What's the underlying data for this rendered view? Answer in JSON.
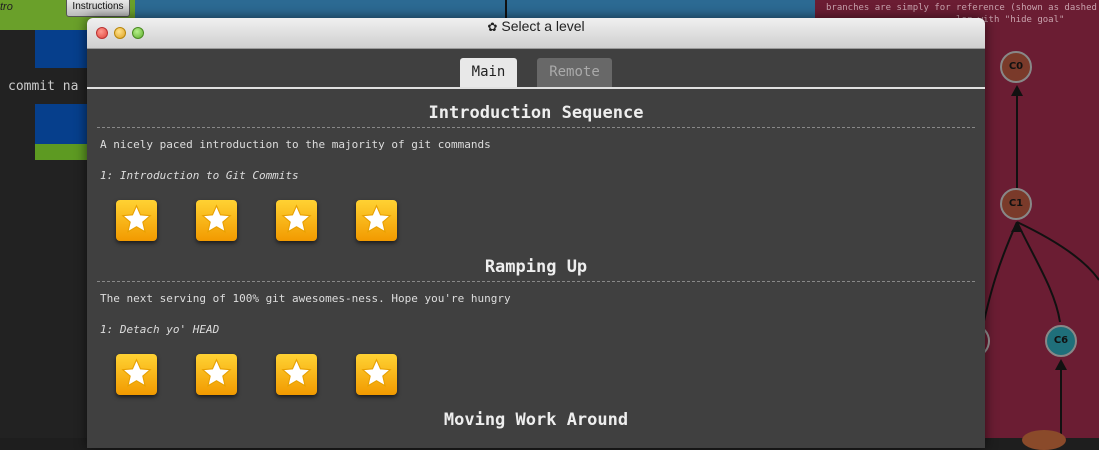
{
  "background": {
    "intro_label": "tro",
    "instructions_button": "Instructions",
    "commit_text": "commit na",
    "right_panel_text": "branches are simply for reference (shown as dashed\n                        log with \"hide goal\"",
    "nodes": [
      {
        "label": "C0",
        "color": "#7a3a2a"
      },
      {
        "label": "C1",
        "color": "#7a3a2a"
      },
      {
        "label": "C6",
        "color": "#1f6f7a"
      }
    ]
  },
  "dialog": {
    "title": "Select a level",
    "gear_icon": "gear-icon",
    "tabs": [
      {
        "label": "Main",
        "active": true
      },
      {
        "label": "Remote",
        "active": false
      }
    ],
    "sequences": [
      {
        "title": "Introduction Sequence",
        "description": "A nicely paced introduction to the majority of git commands",
        "level_label": "1: Introduction to Git Commits",
        "stars": 4
      },
      {
        "title": "Ramping Up",
        "description": "The next serving of 100% git awesomes-ness. Hope you're hungry",
        "level_label": "1: Detach yo' HEAD",
        "stars": 4
      },
      {
        "title": "Moving Work Around",
        "description": "",
        "level_label": "",
        "stars": 0
      }
    ]
  },
  "colors": {
    "dialog_bg": "#404040",
    "star_button": "#f5b100",
    "right_panel": "#6b1d33"
  }
}
